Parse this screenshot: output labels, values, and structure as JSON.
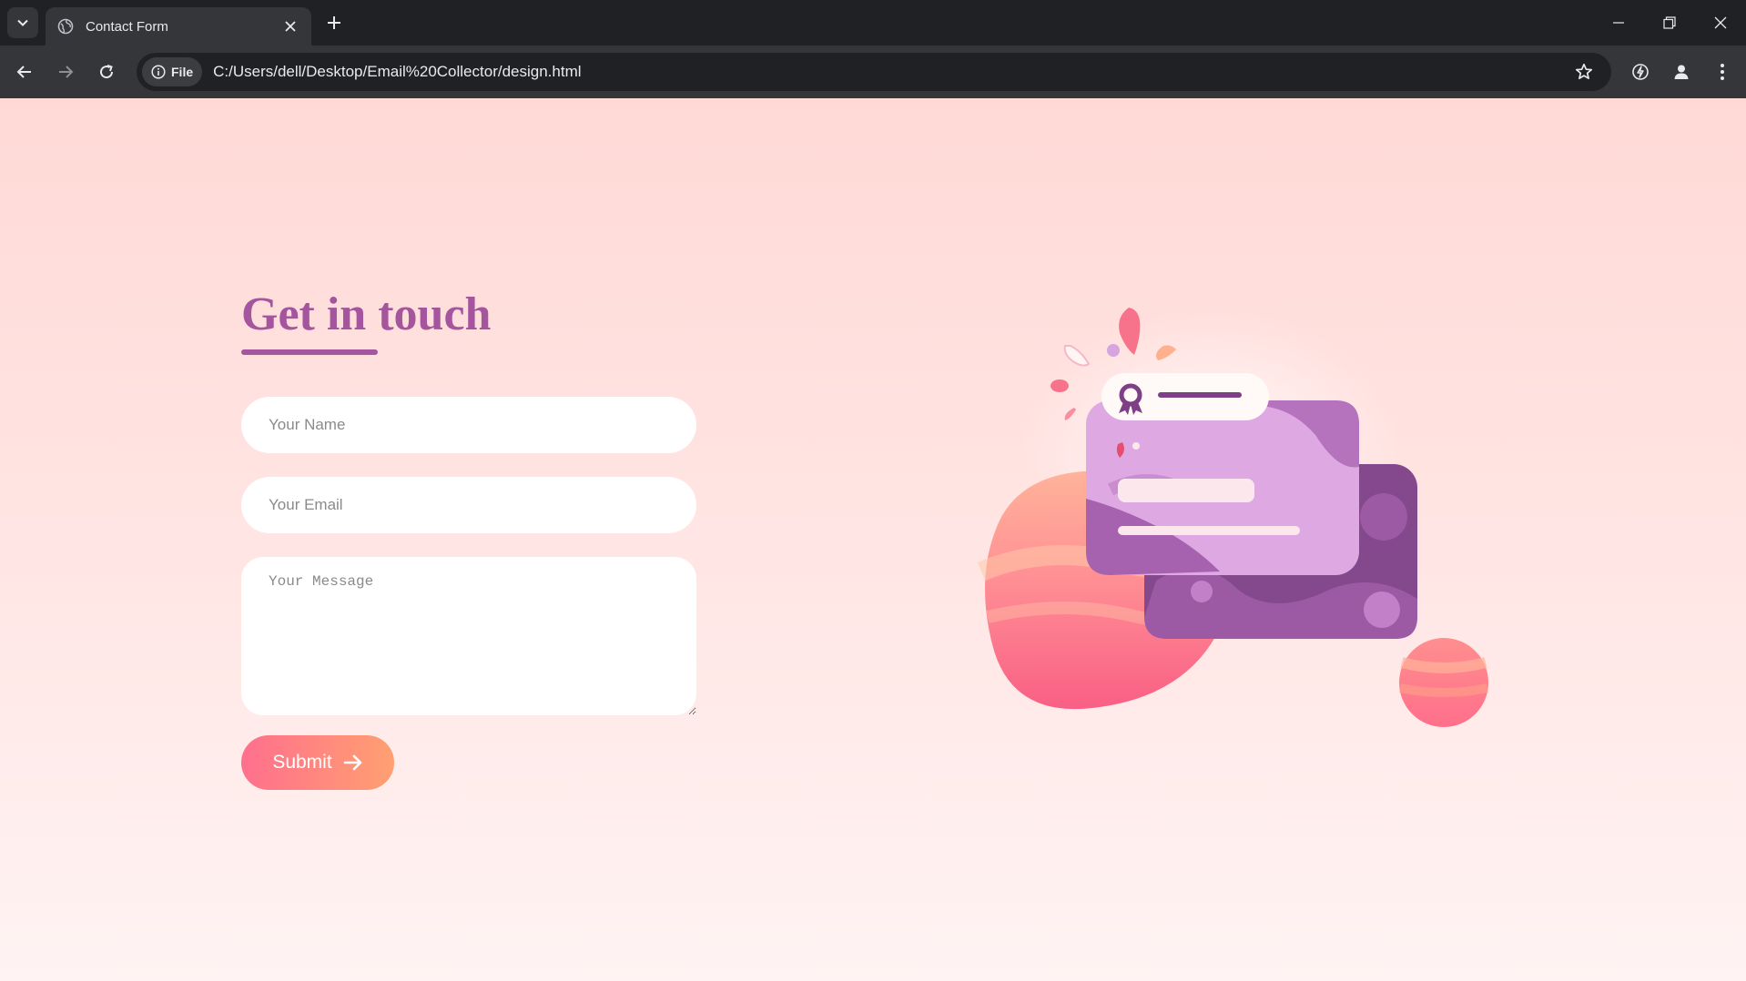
{
  "browser": {
    "tab_title": "Contact Form",
    "site_chip": "File",
    "url": "C:/Users/dell/Desktop/Email%20Collector/design.html"
  },
  "page": {
    "heading": "Get in touch",
    "name_placeholder": "Your Name",
    "email_placeholder": "Your Email",
    "message_placeholder": "Your Message",
    "submit_label": "Submit"
  },
  "colors": {
    "accent": "#a4559d",
    "button_start": "#ff6f8d",
    "button_end": "#ffa071",
    "background": "#ffd9d6"
  },
  "icons": [
    "chevron-down-icon",
    "globe-icon",
    "close-icon",
    "plus-icon",
    "minimize-icon",
    "restore-icon",
    "back-arrow-icon",
    "forward-arrow-icon",
    "reload-icon",
    "info-icon",
    "star-icon",
    "extension-icon",
    "profile-icon",
    "more-vert-icon",
    "arrow-right-icon"
  ]
}
